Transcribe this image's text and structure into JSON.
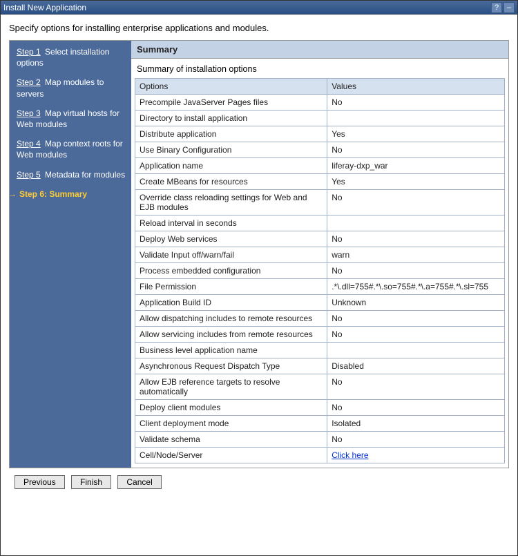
{
  "window": {
    "title": "Install New Application",
    "help": "?",
    "minimize": "–"
  },
  "intro": "Specify options for installing enterprise applications and modules.",
  "sidebar": {
    "steps": [
      {
        "link": "Step 1",
        "rest": "Select installation options"
      },
      {
        "link": "Step 2",
        "rest": "Map modules to servers"
      },
      {
        "link": "Step 3",
        "rest": "Map virtual hosts for Web modules"
      },
      {
        "link": "Step 4",
        "rest": "Map context roots for Web modules"
      },
      {
        "link": "Step 5",
        "rest": "Metadata for modules"
      }
    ],
    "active": "Step 6: Summary"
  },
  "panel": {
    "header": "Summary",
    "subhead": "Summary of installation options",
    "col_options": "Options",
    "col_values": "Values",
    "rows": [
      {
        "o": "Precompile JavaServer Pages files",
        "v": "No"
      },
      {
        "o": "Directory to install application",
        "v": ""
      },
      {
        "o": "Distribute application",
        "v": "Yes"
      },
      {
        "o": "Use Binary Configuration",
        "v": "No"
      },
      {
        "o": "Application name",
        "v": "liferay-dxp_war"
      },
      {
        "o": "Create MBeans for resources",
        "v": "Yes"
      },
      {
        "o": "Override class reloading settings for Web and EJB modules",
        "v": "No"
      },
      {
        "o": "Reload interval in seconds",
        "v": ""
      },
      {
        "o": "Deploy Web services",
        "v": "No"
      },
      {
        "o": "Validate Input off/warn/fail",
        "v": "warn"
      },
      {
        "o": "Process embedded configuration",
        "v": "No"
      },
      {
        "o": "File Permission",
        "v": ".*\\.dll=755#.*\\.so=755#.*\\.a=755#.*\\.sl=755"
      },
      {
        "o": "Application Build ID",
        "v": "Unknown"
      },
      {
        "o": "Allow dispatching includes to remote resources",
        "v": "No"
      },
      {
        "o": "Allow servicing includes from remote resources",
        "v": "No"
      },
      {
        "o": "Business level application name",
        "v": ""
      },
      {
        "o": "Asynchronous Request Dispatch Type",
        "v": "Disabled"
      },
      {
        "o": "Allow EJB reference targets to resolve automatically",
        "v": "No"
      },
      {
        "o": "Deploy client modules",
        "v": "No"
      },
      {
        "o": "Client deployment mode",
        "v": "Isolated"
      },
      {
        "o": "Validate schema",
        "v": "No"
      },
      {
        "o": "Cell/Node/Server",
        "v": "Click here",
        "link": true
      }
    ]
  },
  "buttons": {
    "previous": "Previous",
    "finish": "Finish",
    "cancel": "Cancel"
  }
}
